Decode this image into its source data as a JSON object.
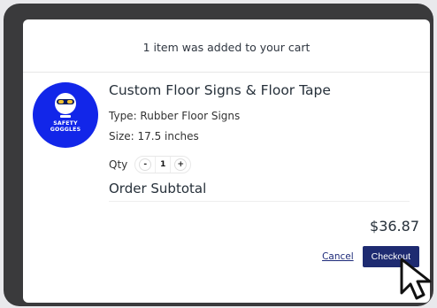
{
  "modal": {
    "header_text": "1 item was added to your cart",
    "product": {
      "badge_text_line1": "SAFETY",
      "badge_text_line2": "GOGGLES",
      "title": "Custom Floor Signs & Floor Tape",
      "type": "Type: Rubber Floor Signs",
      "size": "Size: 17.5 inches",
      "qty_label": "Qty",
      "qty_minus": "-",
      "qty_value": "1",
      "qty_plus": "+"
    },
    "subtotal_label": "Order Subtotal",
    "subtotal_value": "$36.87",
    "actions": {
      "cancel_label": "Cancel",
      "checkout_label": "Checkout"
    }
  },
  "colors": {
    "brand_blue": "#1226e9",
    "checkout_bg": "#1e2b71",
    "frame_dark": "#3a3a3c"
  },
  "icons": {
    "cursor": "arrow-cursor-icon"
  }
}
